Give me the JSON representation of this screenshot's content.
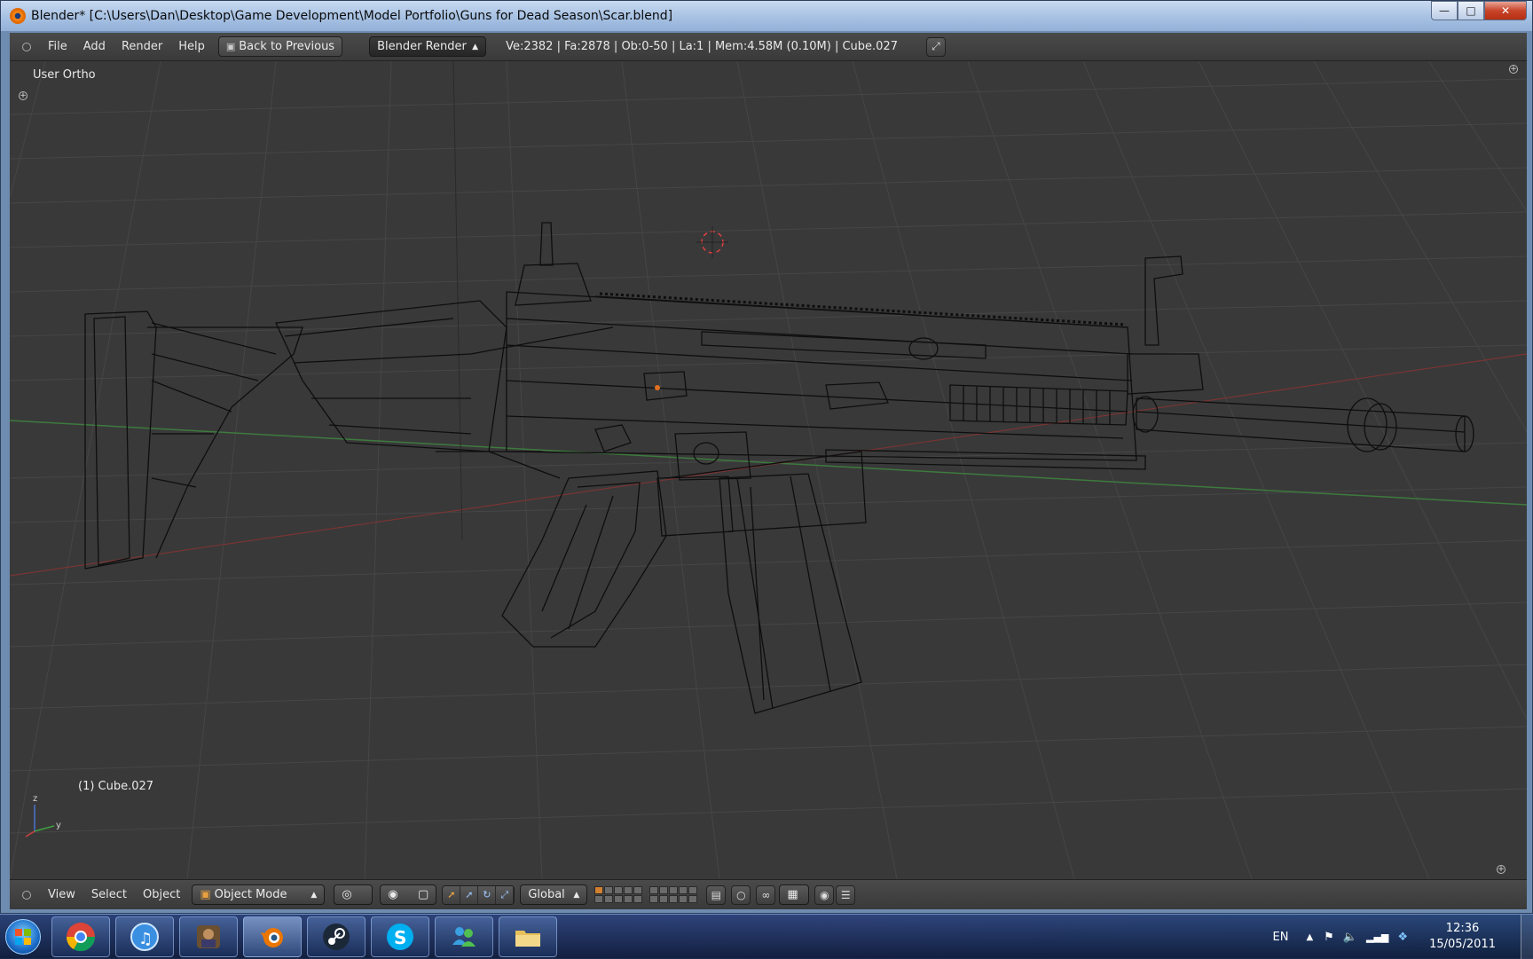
{
  "window": {
    "title": "Blender* [C:\\Users\\Dan\\Desktop\\Game Development\\Model Portfolio\\Guns for Dead Season\\Scar.blend]"
  },
  "header": {
    "menus": [
      "File",
      "Add",
      "Render",
      "Help"
    ],
    "back_button": "Back to Previous",
    "render_engine": "Blender Render",
    "stats": "Ve:2382 | Fa:2878 | Ob:0-50 | La:1 | Mem:4.58M (0.10M) | Cube.027"
  },
  "viewport": {
    "view_label": "User Ortho",
    "active_object": "(1) Cube.027",
    "axis_labels": {
      "z": "z",
      "y": "y"
    }
  },
  "footer": {
    "menus": [
      "View",
      "Select",
      "Object"
    ],
    "mode": "Object Mode",
    "orientation": "Global"
  },
  "taskbar": {
    "apps": [
      "chrome-icon",
      "itunes-icon",
      "game-icon",
      "blender-icon",
      "steam-icon",
      "skype-icon",
      "messenger-icon",
      "explorer-icon"
    ],
    "language": "EN",
    "time": "12:36",
    "date": "15/05/2011"
  },
  "colors": {
    "viewport_bg": "#393939",
    "grid_line": "#4a4a4a",
    "x_axis": "#8a3a3a",
    "y_axis": "#3e7a3e",
    "wire": "#0e0e0e"
  }
}
